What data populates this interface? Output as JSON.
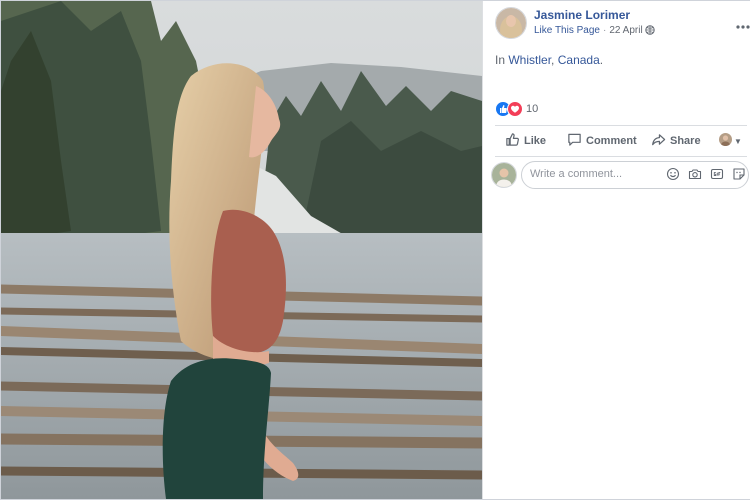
{
  "post": {
    "author": "Jasmine Lorimer",
    "like_page": "Like This Page",
    "separator": "·",
    "date": "22 April",
    "location_prefix": "In",
    "city": "Whistler",
    "comma": ",",
    "country": "Canada",
    "period": "."
  },
  "reactions": {
    "count": "10",
    "types": [
      "like-icon",
      "love-icon"
    ]
  },
  "actions": {
    "like": "Like",
    "comment": "Comment",
    "share": "Share"
  },
  "comment": {
    "placeholder": "Write a comment..."
  },
  "colors": {
    "link": "#365899",
    "like": "#1877f2",
    "love": "#f33e58",
    "muted": "#616770"
  }
}
